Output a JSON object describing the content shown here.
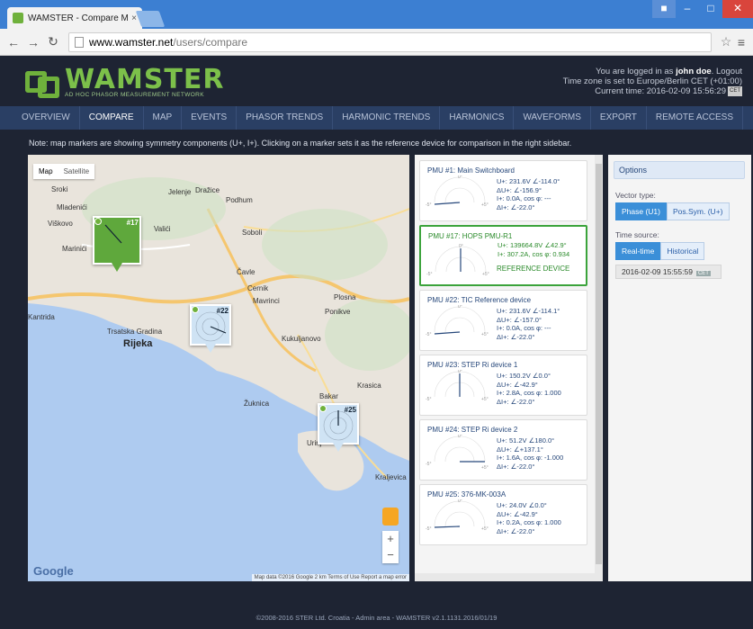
{
  "browser": {
    "tab_title": "WAMSTER - Compare Me",
    "tab_close": "×",
    "url_domain": "www.wamster.net",
    "url_path": "/users/compare"
  },
  "header": {
    "logo_word": "WAMSTER",
    "logo_sub": "AD HOC PHASOR MEASUREMENT NETWORK",
    "login_prefix": "You are logged in as",
    "user": "john doe",
    "logout": "Logout",
    "timezone": "Time zone is set to Europe/Berlin CET (+01:00)",
    "current_time": "Current time: 2016-02-09 15:56:29",
    "cal_badge": "CET"
  },
  "nav": [
    "OVERVIEW",
    "COMPARE",
    "MAP",
    "EVENTS",
    "PHASOR TRENDS",
    "HARMONIC TRENDS",
    "HARMONICS",
    "WAVEFORMS",
    "EXPORT",
    "REMOTE ACCESS"
  ],
  "note": "Note: map markers are showing symmetry components (U+, I+). Clicking on a marker sets it as the reference device for comparison in the right sidebar.",
  "map": {
    "type_map": "Map",
    "type_satellite": "Satellite",
    "places": [
      "Sroki",
      "Jelenje",
      "Dražice",
      "Mladenići",
      "Podhum",
      "Viškovo",
      "Valići",
      "Soboli",
      "Marinići",
      "Čavle",
      "Cernik",
      "Mavrinci",
      "Plosna",
      "Ponikve",
      "Kantrida",
      "Trsatska Gradina",
      "Rijeka",
      "Kukuljanovo",
      "Krasica",
      "Bakar",
      "Žuknica",
      "Urinj",
      "Kraljevica"
    ],
    "markers": [
      "#17",
      "#22",
      "#25"
    ],
    "google": "Google",
    "attribution": "Map data ©2016 Google   2 km        Terms of Use   Report a map error",
    "zoom_in": "+",
    "zoom_out": "−"
  },
  "pmus": [
    {
      "title": "PMU #1:   Main Switchboard",
      "u": "U+: 231.6V ∠-114.0°",
      "du": "ΔU+: ∠-156.9°",
      "i": "I+: 0.0A, cos φ: ---",
      "di": "ΔI+: ∠-22.0°"
    },
    {
      "title": "PMU #17:  HOPS PMU-R1",
      "u": "U+: 139664.8V ∠42.9°",
      "i": "I+: 307.2A, cos φ: 0.934",
      "ref": "REFERENCE DEVICE"
    },
    {
      "title": "PMU #22:  TIC Reference device",
      "u": "U+: 231.6V ∠-114.1°",
      "du": "ΔU+: ∠-157.0°",
      "i": "I+: 0.0A, cos φ: ---",
      "di": "ΔI+: ∠-22.0°"
    },
    {
      "title": "PMU #23:  STEP Ri device 1",
      "u": "U+: 150.2V ∠0.0°",
      "du": "ΔU+: ∠-42.9°",
      "i": "I+: 2.8A, cos φ: 1.000",
      "di": "ΔI+: ∠-22.0°"
    },
    {
      "title": "PMU #24:  STEP Ri device 2",
      "u": "U+: 51.2V ∠180.0°",
      "du": "ΔU+: ∠+137.1°",
      "i": "I+: 1.6A, cos φ: -1.000",
      "di": "ΔI+: ∠-22.0°"
    },
    {
      "title": "PMU #25:  376-MK-003A",
      "u": "U+: 24.0V ∠0.0°",
      "du": "ΔU+: ∠-42.9°",
      "i": "I+: 0.2A, cos φ: 1.000",
      "di": "ΔI+: ∠-22.0°"
    }
  ],
  "options": {
    "header": "Options",
    "vector_label": "Vector type:",
    "vector_phase": "Phase (U1)",
    "vector_pos": "Pos.Sym. (U+)",
    "time_label": "Time source:",
    "time_real": "Real-time",
    "time_hist": "Historical",
    "date": "2016-02-09 15:55:59",
    "date_badge": "CET"
  },
  "footer": "©2008-2016 STER Ltd. Croatia - Admin area - WAMSTER v2.1.1131.2016/01/19"
}
